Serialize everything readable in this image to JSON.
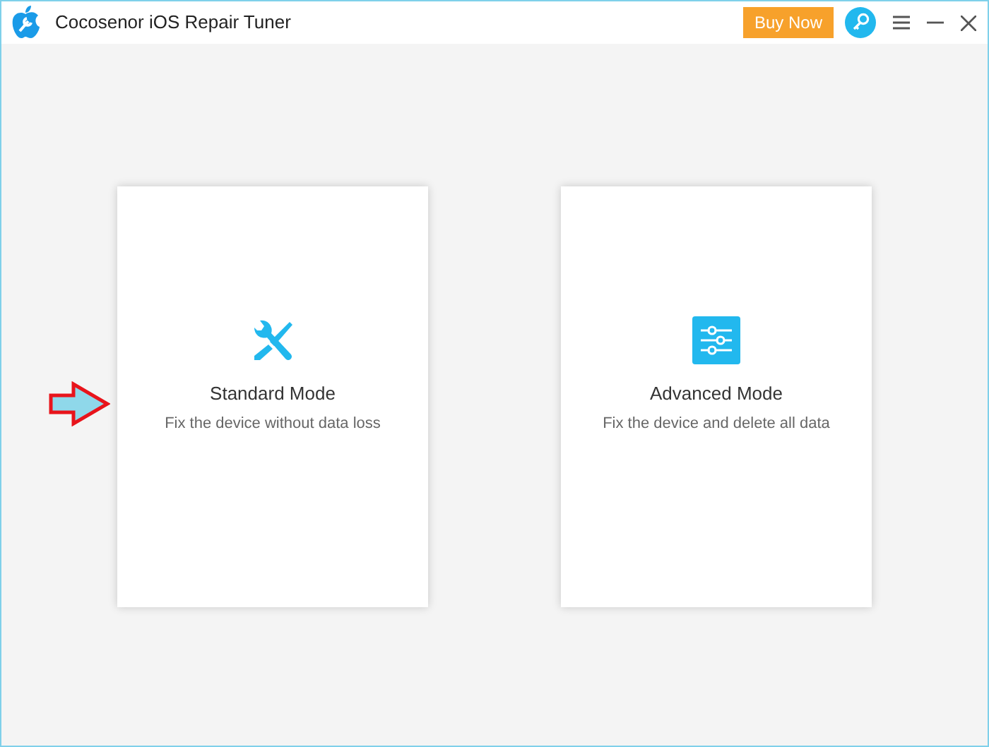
{
  "window": {
    "title": "Cocosenor iOS Repair Tuner",
    "buy_button": "Buy Now"
  },
  "modes": [
    {
      "kind": "tools",
      "title": "Standard Mode",
      "description": "Fix the device without data loss"
    },
    {
      "kind": "sliders",
      "title": "Advanced Mode",
      "description": "Fix the device and delete all data"
    }
  ]
}
